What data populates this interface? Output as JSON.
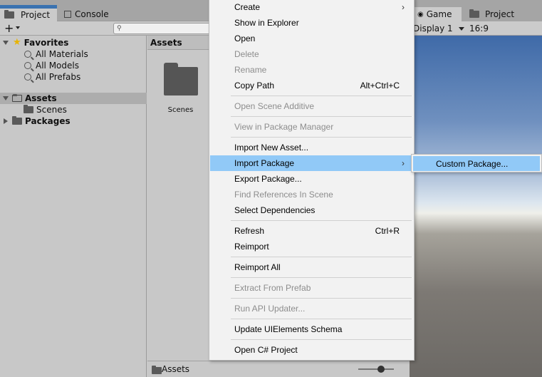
{
  "project_panel": {
    "tabs": [
      {
        "label": "Project"
      },
      {
        "label": "Console"
      }
    ],
    "toolbar": {
      "plus_glyph": "+",
      "search_placeholder": ""
    },
    "tree": {
      "favorites_label": "Favorites",
      "favorites_items": [
        "All Materials",
        "All Models",
        "All Prefabs"
      ],
      "assets_label": "Assets",
      "assets_children": [
        "Scenes"
      ],
      "packages_label": "Packages"
    },
    "assets_pane": {
      "header": "Assets",
      "items": [
        {
          "label": "Scenes"
        }
      ]
    },
    "bottom_bar": {
      "path": "Assets"
    }
  },
  "game_panel": {
    "tabs": [
      {
        "label": "Game"
      },
      {
        "label": "Project"
      }
    ],
    "toolbar": {
      "display": "Display 1",
      "aspect": "16:9"
    }
  },
  "context_menu": {
    "items": [
      {
        "label": "Create",
        "shortcut": "",
        "submenu": true,
        "disabled": false
      },
      {
        "label": "Show in Explorer",
        "shortcut": "",
        "disabled": false
      },
      {
        "label": "Open",
        "shortcut": "",
        "disabled": false
      },
      {
        "label": "Delete",
        "shortcut": "",
        "disabled": true
      },
      {
        "label": "Rename",
        "shortcut": "",
        "disabled": true
      },
      {
        "label": "Copy Path",
        "shortcut": "Alt+Ctrl+C",
        "disabled": false
      },
      {
        "label": "Open Scene Additive",
        "shortcut": "",
        "disabled": true
      },
      {
        "label": "View in Package Manager",
        "shortcut": "",
        "disabled": true
      },
      {
        "label": "Import New Asset...",
        "shortcut": "",
        "disabled": false
      },
      {
        "label": "Import Package",
        "shortcut": "",
        "submenu": true,
        "highlighted": true,
        "disabled": false
      },
      {
        "label": "Export Package...",
        "shortcut": "",
        "disabled": false
      },
      {
        "label": "Find References In Scene",
        "shortcut": "",
        "disabled": true
      },
      {
        "label": "Select Dependencies",
        "shortcut": "",
        "disabled": false
      },
      {
        "label": "Refresh",
        "shortcut": "Ctrl+R",
        "disabled": false
      },
      {
        "label": "Reimport",
        "shortcut": "",
        "disabled": false
      },
      {
        "label": "Reimport All",
        "shortcut": "",
        "disabled": false
      },
      {
        "label": "Extract From Prefab",
        "shortcut": "",
        "disabled": true
      },
      {
        "label": "Run API Updater...",
        "shortcut": "",
        "disabled": true
      },
      {
        "label": "Update UIElements Schema",
        "shortcut": "",
        "disabled": false
      },
      {
        "label": "Open C# Project",
        "shortcut": "",
        "disabled": false
      }
    ],
    "submenu_arrow": "›",
    "submenu": {
      "items": [
        {
          "label": "Custom Package..."
        }
      ]
    }
  },
  "colors": {
    "highlight": "#91c9f7",
    "tab_accent": "#3a72b0",
    "disabled_text": "#8d8d8d",
    "star": "#e8b400"
  }
}
